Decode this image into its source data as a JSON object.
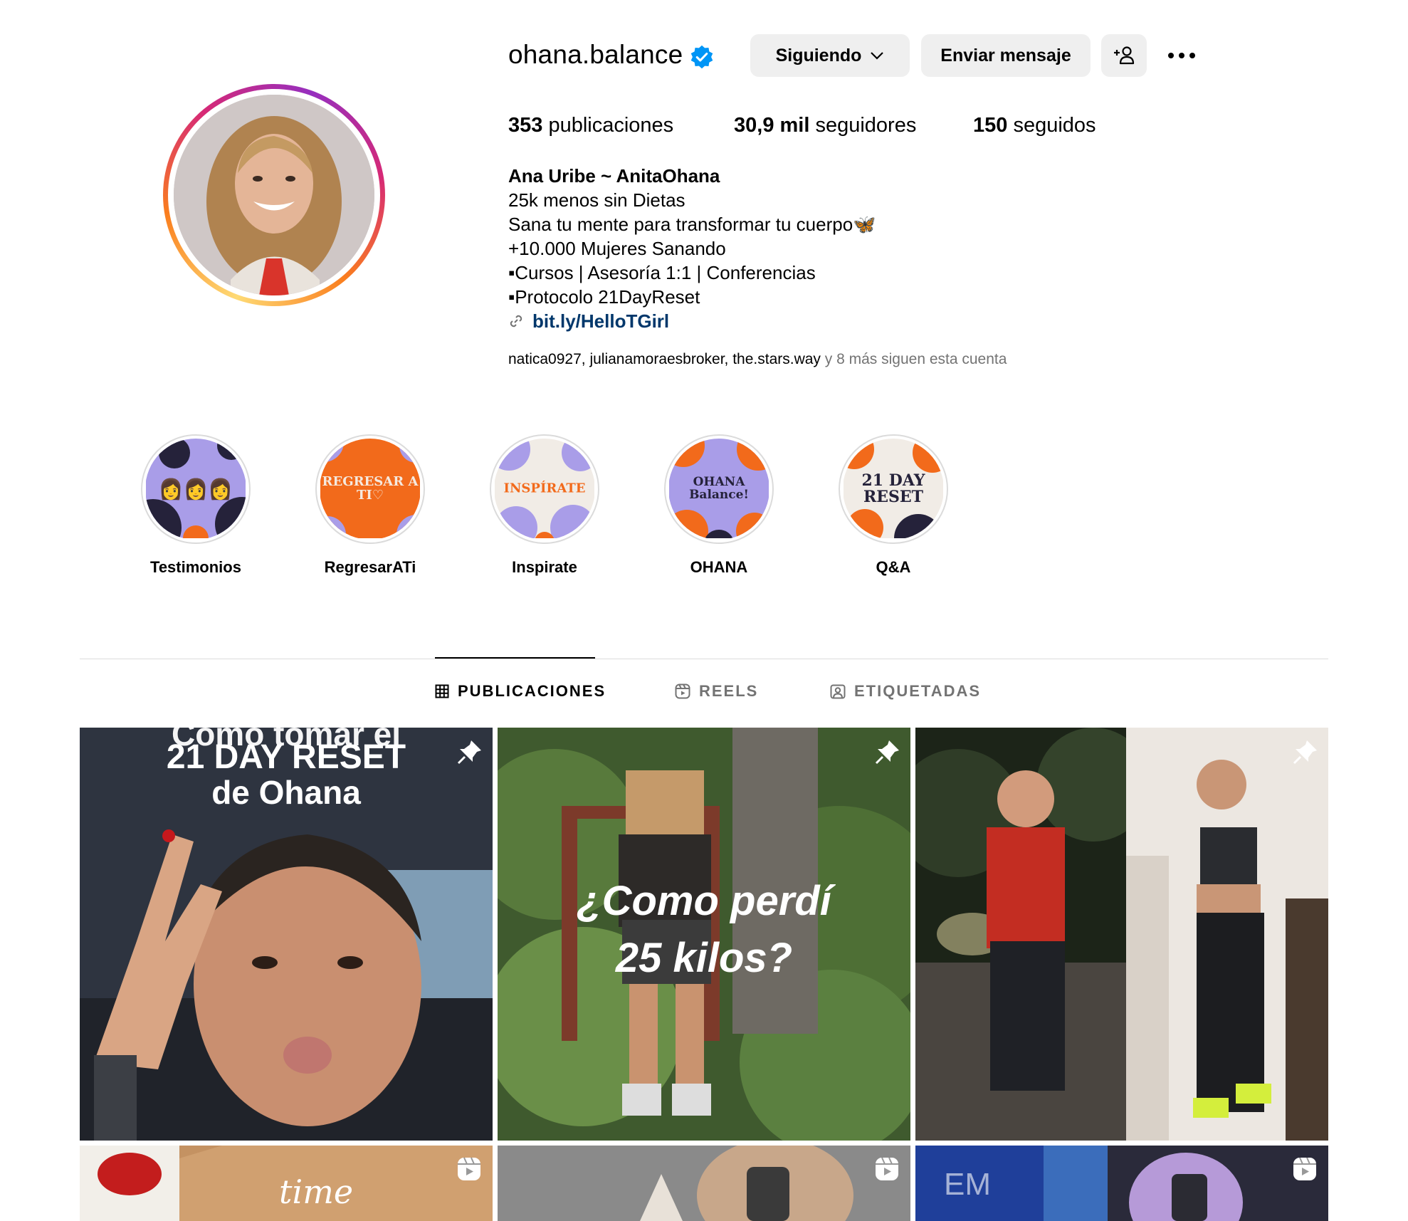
{
  "profile": {
    "username": "ohana.balance",
    "buttons": {
      "following": "Siguiendo",
      "message": "Enviar mensaje"
    },
    "stats": [
      {
        "value": "353",
        "label": "publicaciones"
      },
      {
        "value": "30,9 mil",
        "label": "seguidores"
      },
      {
        "value": "150",
        "label": "seguidos"
      }
    ],
    "bio": {
      "name": "Ana Uribe ~ AnitaOhana",
      "lines": [
        "25k menos sin Dietas",
        "Sana tu mente para transformar tu cuerpo🦋",
        "+10.000 Mujeres Sanando",
        "▪Cursos | Asesoría 1:1 | Conferencias",
        "▪Protocolo 21DayReset"
      ],
      "link": "bit.ly/HelloTGirl"
    },
    "followed_by": {
      "users": [
        "natica0927",
        "julianamoraesbroker",
        "the.stars.way"
      ],
      "suffix": "y 8 más siguen esta cuenta"
    }
  },
  "highlights": [
    {
      "label": "Testimonios",
      "cover_text": "👩👩👩"
    },
    {
      "label": "RegresarATi",
      "cover_text": "REGRESAR A TI♡"
    },
    {
      "label": "Inspirate",
      "cover_text": "INSPÍRATE"
    },
    {
      "label": "OHANA",
      "cover_text": "OHANA Balance!"
    },
    {
      "label": "Q&A",
      "cover_text": "21 DAY RESET"
    }
  ],
  "tabs": [
    {
      "label": "PUBLICACIONES",
      "active": true
    },
    {
      "label": "REELS",
      "active": false
    },
    {
      "label": "ETIQUETADAS",
      "active": false
    }
  ],
  "posts": [
    {
      "overlay_top": "Como tomar el",
      "overlay_main": "21 DAY RESET",
      "overlay_sub": "de Ohana",
      "badge": "pin-icon"
    },
    {
      "overlay_main": "¿Como perdí",
      "overlay_sub": "25 kilos?",
      "badge": "pin-icon"
    },
    {
      "badge": "pin-icon"
    },
    {
      "overlay_main": "time",
      "badge": "reel-icon"
    },
    {
      "badge": "reel-icon"
    },
    {
      "overlay_main": "EM",
      "badge": "reel-icon"
    }
  ],
  "colors": {
    "link": "#00376b",
    "button_bg": "#efefef",
    "verified": "#0095f6",
    "highlight_purple": "#a99de8",
    "highlight_orange": "#f26a1b"
  }
}
